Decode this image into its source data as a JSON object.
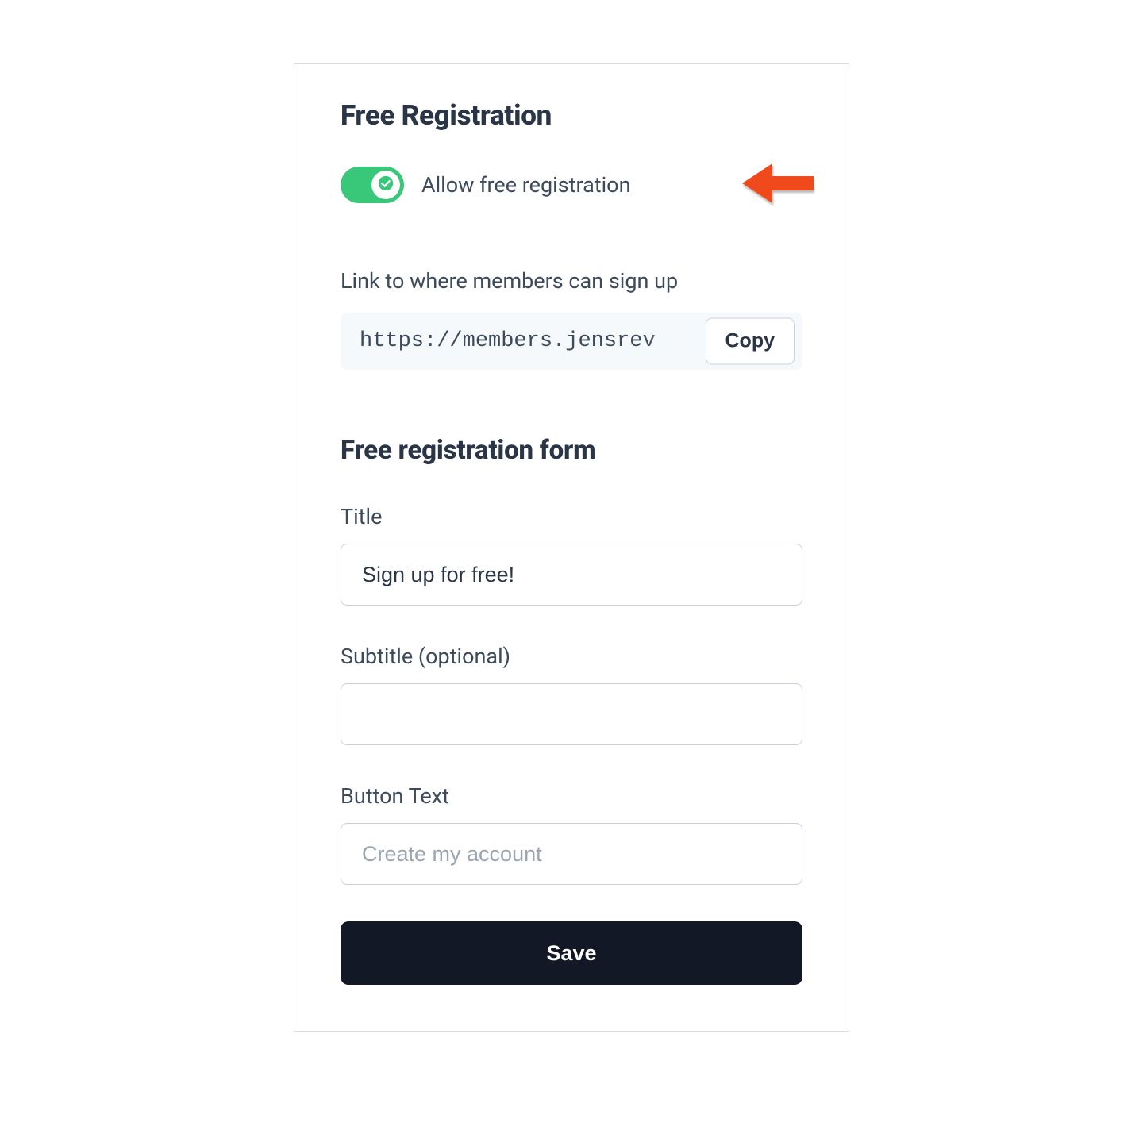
{
  "header": {
    "title": "Free Registration"
  },
  "toggle": {
    "label": "Allow free registration",
    "enabled": true
  },
  "link": {
    "label": "Link to where members can sign up",
    "url": "https://members.jensrev",
    "copy_label": "Copy"
  },
  "form": {
    "heading": "Free registration form",
    "title_label": "Title",
    "title_value": "Sign up for free!",
    "subtitle_label": "Subtitle (optional)",
    "subtitle_value": "",
    "button_text_label": "Button Text",
    "button_text_value": "",
    "button_text_placeholder": "Create my account",
    "save_label": "Save"
  },
  "annotation": {
    "arrow_color": "#f04a1d"
  }
}
